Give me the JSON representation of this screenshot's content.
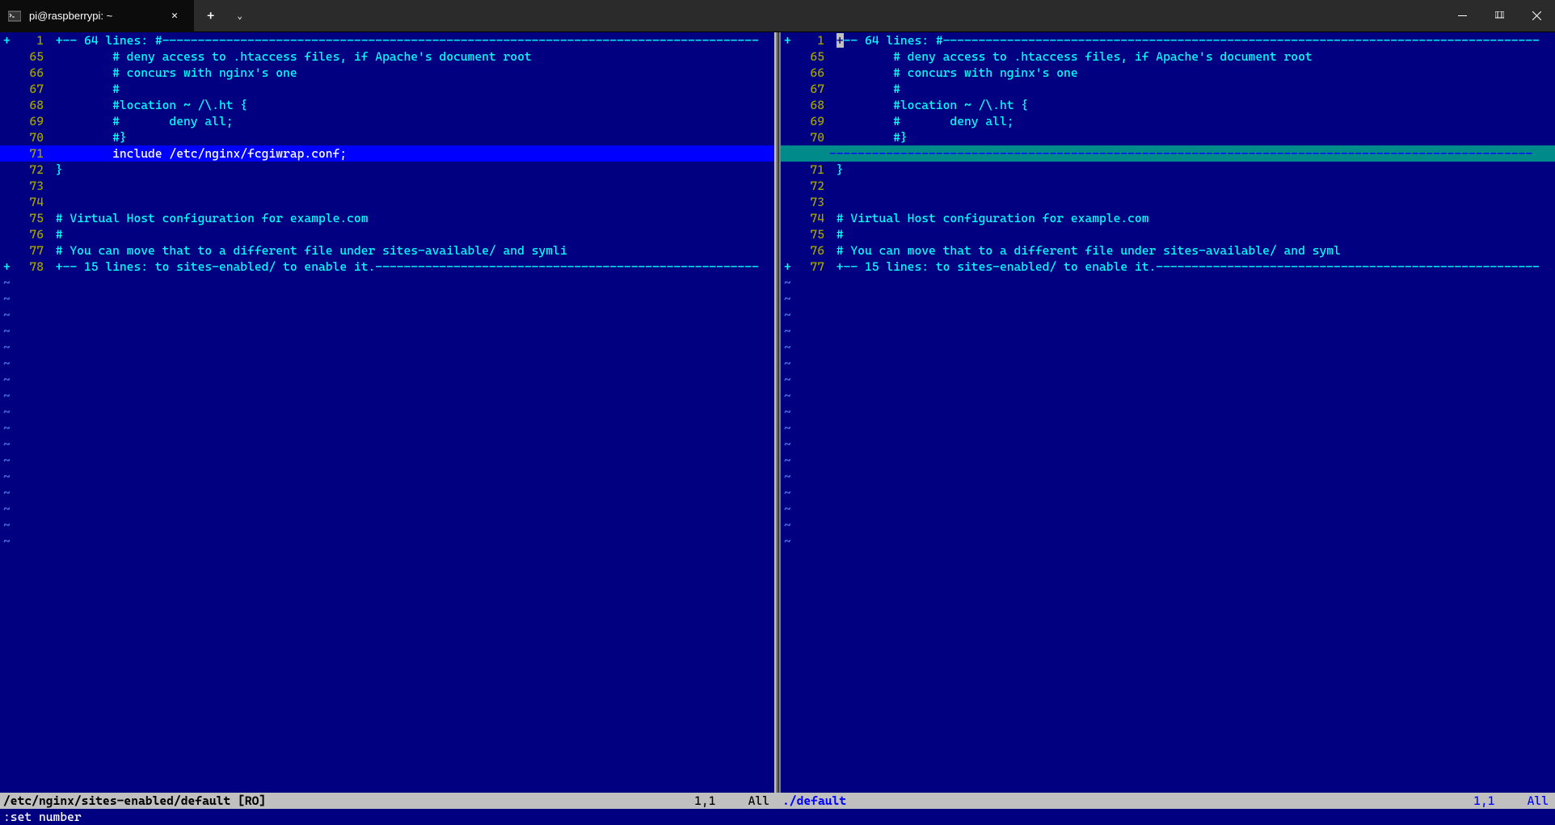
{
  "titlebar": {
    "tab_title": "pi@raspberrypi: ~",
    "tab_icon": "terminal-icon"
  },
  "left_pane": {
    "fold_top": {
      "sign": "+",
      "num": "1",
      "text": "+-- 64 lines: #"
    },
    "lines": [
      {
        "num": "65",
        "text": "        # deny access to .htaccess files, if Apache's document root"
      },
      {
        "num": "66",
        "text": "        # concurs with nginx's one"
      },
      {
        "num": "67",
        "text": "        #"
      },
      {
        "num": "68",
        "text": "        #location ~ /\\.ht {"
      },
      {
        "num": "69",
        "text": "        #       deny all;"
      },
      {
        "num": "70",
        "text": "        #}"
      },
      {
        "num": "71",
        "text": "        include /etc/nginx/fcgiwrap.conf;",
        "diff": "add"
      },
      {
        "num": "72",
        "text": "}"
      },
      {
        "num": "73",
        "text": ""
      },
      {
        "num": "74",
        "text": ""
      },
      {
        "num": "75",
        "text": "# Virtual Host configuration for example.com"
      },
      {
        "num": "76",
        "text": "#"
      },
      {
        "num": "77",
        "text": "# You can move that to a different file under sites-available/ and symli"
      }
    ],
    "fold_bot": {
      "sign": "+",
      "num": "78",
      "text": "+-- 15 lines: to sites-enabled/ to enable it."
    },
    "tilde_count": 17
  },
  "right_pane": {
    "fold_top": {
      "sign": "+",
      "num": "1",
      "text": "+-- 64 lines: #",
      "cursor": true
    },
    "lines": [
      {
        "num": "65",
        "text": "        # deny access to .htaccess files, if Apache's document root"
      },
      {
        "num": "66",
        "text": "        # concurs with nginx's one"
      },
      {
        "num": "67",
        "text": "        #"
      },
      {
        "num": "68",
        "text": "        #location ~ /\\.ht {"
      },
      {
        "num": "69",
        "text": "        #       deny all;"
      },
      {
        "num": "70",
        "text": "        #}"
      },
      {
        "num": "",
        "text": "",
        "diff": "del"
      },
      {
        "num": "71",
        "text": "}"
      },
      {
        "num": "72",
        "text": ""
      },
      {
        "num": "73",
        "text": ""
      },
      {
        "num": "74",
        "text": "# Virtual Host configuration for example.com"
      },
      {
        "num": "75",
        "text": "#"
      },
      {
        "num": "76",
        "text": "# You can move that to a different file under sites-available/ and syml"
      }
    ],
    "fold_bot": {
      "sign": "+",
      "num": "77",
      "text": "+-- 15 lines: to sites-enabled/ to enable it."
    },
    "tilde_count": 17
  },
  "status_left": {
    "file": "/etc/nginx/sites-enabled/default [RO]",
    "pos": "1,1",
    "pct": "All"
  },
  "status_right": {
    "file": "./default",
    "pos": "1,1",
    "pct": "All"
  },
  "cmdline": ":set number"
}
